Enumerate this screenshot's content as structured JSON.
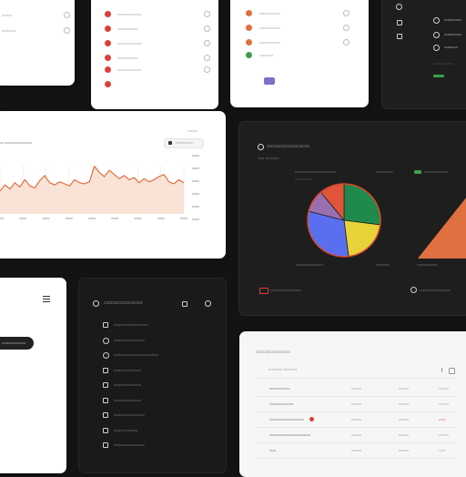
{
  "panels": {
    "topleft": {
      "rows": [
        "▭▭▭",
        "▭▭▭▭"
      ]
    },
    "topmid": {
      "rows": [
        "▭▭▭▭▭▭▭",
        "▭▭▭▭▭▭",
        "▭▭▭▭▭▭▭",
        "▭▭▭▭▭▭",
        "▭▭▭▭▭▭▭"
      ]
    },
    "topright": {
      "rows": [
        "▭▭▭▭▭▭",
        "▭▭▭▭▭▭",
        "▭▭▭▭▭▭",
        "▭▭▭▭"
      ],
      "button": "▭"
    },
    "topdark": {
      "rows": [
        "▭▭▭▭▭",
        "▭▭▭▭▭",
        "▭▭▭▭",
        "▭▭▭▭▭▭"
      ]
    },
    "linechart": {
      "header": "▭▭▭",
      "title": "▭ ▭▭▭▭▭▭▭▭",
      "badge": "▭▭▭▭▭"
    },
    "piechart": {
      "title": "▭▭▭▭▭▭▭▭▭▭",
      "subtitle": "▭▭  ▭▭▭▭",
      "legend_left": "▭▭▭▭▭▭▭▭▭▭▭▭",
      "legend_left2": "▭▭▭▭▭",
      "legend_mid": "▭▭▭▭▭",
      "legend_right": "▭▭▭▭▭▭▭",
      "foot_left": "▭▭▭▭▭▭▭▭",
      "foot_mid": "▭▭▭▭",
      "foot_right": "▭▭▭▭▭▭",
      "bottom_left": "▭▭▭▭▭▭▭▭▭",
      "bottom_right": "▭▭▭▭▭▭▭▭▭"
    },
    "sidebar": {
      "pill": "▭▭▭▭▭▭▭"
    },
    "darklist": {
      "title": "▭▭▭▭▭▭▭▭▭",
      "items": [
        "▭▭▭▭▭▭▭▭▭▭",
        "▭▭▭▭▭▭▭▭▭",
        "▭▭▭▭▭▭▭▭▭▭▭▭▭",
        "▭▭▭▭▭▭▭▭",
        "▭▭▭▭▭▭▭▭",
        "▭▭▭▭▭▭▭▭",
        "▭▭▭▭▭▭▭▭▭",
        "▭▭▭▭▭▭▭",
        "▭▭▭▭▭▭▭▭▭"
      ]
    },
    "table": {
      "title": "▭▭▭▭▭▭▭▭",
      "subtitle": "▭▭▭▭  ▭▭▭▭",
      "rows": [
        {
          "name": "▭▭▭▭▭▭",
          "a": "▭▭▭",
          "b": "▭▭▭",
          "c": "▭▭▭"
        },
        {
          "name": "▭▭▭▭▭▭▭",
          "a": "▭▭▭",
          "b": "▭▭▭",
          "c": "▭▭▭"
        },
        {
          "name": "▭▭▭▭▭▭▭▭▭▭",
          "a": "▭▭▭",
          "b": "▭▭▭",
          "c": "▭▭"
        },
        {
          "name": "▭▭▭▭▭▭▭▭▭▭▭▭",
          "a": "▭▭▭",
          "b": "▭▭▭",
          "c": "▭▭▭"
        },
        {
          "name": "▭▭",
          "a": "▭▭▭",
          "b": "▭▭▭",
          "c": "▭▭"
        }
      ]
    }
  },
  "colors": {
    "accent_orange": "#e07040",
    "accent_red": "#d9413a",
    "pie_green": "#1f8a4c",
    "pie_yellow": "#e8d23a",
    "pie_blue": "#5a6ff0",
    "pie_purple": "#9a6fb0",
    "pie_red": "#e0553a"
  },
  "icons": [
    "more-vertical-icon",
    "gear-icon",
    "list-icon",
    "menu-icon",
    "filter-icon"
  ],
  "chart_data": [
    {
      "type": "area",
      "values": [
        22,
        28,
        24,
        30,
        26,
        33,
        27,
        25,
        32,
        37,
        30,
        28,
        31,
        29,
        27,
        33,
        30,
        29,
        31,
        46,
        40,
        36,
        42,
        38,
        34,
        37,
        33,
        35,
        30,
        34,
        31,
        33,
        36,
        38,
        31,
        29,
        33,
        30
      ]
    },
    {
      "type": "pie",
      "values": [
        27,
        21,
        31,
        10,
        11
      ]
    }
  ]
}
